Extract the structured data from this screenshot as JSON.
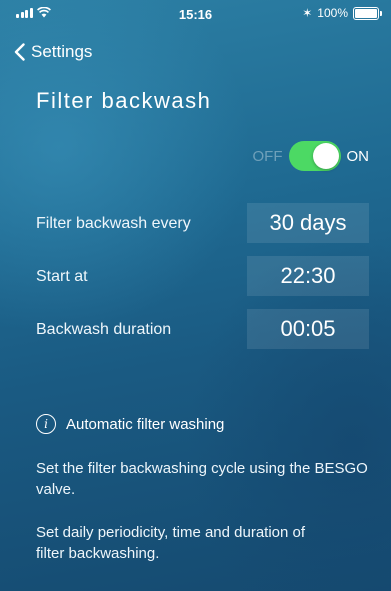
{
  "status_bar": {
    "time": "15:16",
    "battery": "100%",
    "bluetooth_symbol": "✶"
  },
  "nav": {
    "back_label": "Settings"
  },
  "page": {
    "title": "Filter backwash"
  },
  "toggle": {
    "off_label": "OFF",
    "on_label": "ON",
    "state": "on",
    "color": "#4cd964"
  },
  "settings": [
    {
      "label": "Filter backwash every",
      "value": "30 days"
    },
    {
      "label": "Start at",
      "value": "22:30"
    },
    {
      "label": "Backwash duration",
      "value": "00:05"
    }
  ],
  "info": {
    "icon_glyph": "i",
    "heading": "Automatic filter washing",
    "paragraph_1": "Set the filter backwashing cycle using the BESGO valve.",
    "paragraph_2": "Set daily periodicity, time and duration of filter backwashing."
  }
}
